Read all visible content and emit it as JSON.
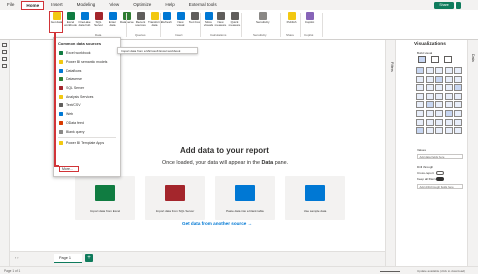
{
  "menu": {
    "items": [
      "File",
      "Home",
      "Insert",
      "Modeling",
      "View",
      "Optimize",
      "Help",
      "External tools"
    ],
    "active": "Home",
    "share_label": "Share"
  },
  "ribbon": {
    "buttons": [
      {
        "label": "Get data",
        "icon": "database-icon",
        "color": "#f2c811"
      },
      {
        "label": "Excel workbook",
        "icon": "excel-icon",
        "color": "#107c41"
      },
      {
        "label": "OneLake data hub",
        "icon": "onelake-icon",
        "color": "#0078d4"
      },
      {
        "label": "SQL Server",
        "icon": "sql-icon",
        "color": "#a4262c"
      },
      {
        "label": "Enter data",
        "icon": "table-icon",
        "color": "#0078d4"
      },
      {
        "label": "Dataverse",
        "icon": "dataverse-icon",
        "color": "#2e7d32"
      },
      {
        "label": "Recent sources",
        "icon": "recent-icon",
        "color": "#605e5c"
      },
      {
        "label": "Transform data",
        "icon": "transform-icon",
        "color": "#f2c811"
      },
      {
        "label": "Refresh",
        "icon": "refresh-icon",
        "color": "#0078d4"
      },
      {
        "label": "New visual",
        "icon": "chart-icon",
        "color": "#0078d4"
      },
      {
        "label": "Text box",
        "icon": "textbox-icon",
        "color": "#605e5c"
      },
      {
        "label": "More visuals",
        "icon": "visuals-icon",
        "color": "#0078d4"
      },
      {
        "label": "New measure",
        "icon": "measure-icon",
        "color": "#605e5c"
      },
      {
        "label": "Quick measure",
        "icon": "quick-measure-icon",
        "color": "#605e5c"
      },
      {
        "label": "Sensitivity",
        "icon": "shield-icon",
        "color": "#8a8886"
      },
      {
        "label": "Publish",
        "icon": "publish-icon",
        "color": "#f2c811"
      },
      {
        "label": "Copilot",
        "icon": "copilot-icon",
        "color": "#8764b8"
      }
    ],
    "groups": [
      "Data",
      "Queries",
      "Insert",
      "Calculations",
      "Sensitivity",
      "Share",
      "Copilot"
    ]
  },
  "dropdown": {
    "heading": "Common data sources",
    "items": [
      {
        "label": "Excel workbook",
        "color": "#107c41"
      },
      {
        "label": "Power BI semantic models",
        "color": "#f2c811"
      },
      {
        "label": "Dataflows",
        "color": "#0078d4"
      },
      {
        "label": "Dataverse",
        "color": "#2e7d32"
      },
      {
        "label": "SQL Server",
        "color": "#a4262c"
      },
      {
        "label": "Analysis Services",
        "color": "#f2c811"
      },
      {
        "label": "Text/CSV",
        "color": "#605e5c"
      },
      {
        "label": "Web",
        "color": "#0078d4"
      },
      {
        "label": "OData feed",
        "color": "#d83b01"
      },
      {
        "label": "Blank query",
        "color": "#8a8886"
      }
    ],
    "template_apps": "Power BI Template Apps",
    "more": "More...",
    "tooltip": "Import data from a Microsoft Excel workbook"
  },
  "canvas": {
    "title": "Add data to your report",
    "subtitle_prefix": "Once loaded, your data will appear in the",
    "subtitle_bold": "Data",
    "subtitle_suffix": "pane.",
    "cards": [
      {
        "label": "Import data from Excel",
        "color": "#107c41"
      },
      {
        "label": "Import data from SQL Server",
        "color": "#a4262c"
      },
      {
        "label": "Paste data into a blank table",
        "color": "#0078d4"
      },
      {
        "label": "Use sample data",
        "color": "#0078d4"
      }
    ],
    "other_source": "Get data from another source →"
  },
  "filters": {
    "label": "Filters"
  },
  "visualizations": {
    "title": "Visualizations",
    "build_visual": "Build visual",
    "values_label": "Values",
    "values_placeholder": "Add data fields here",
    "drill_label": "Drill through",
    "cross_report": "Cross-report",
    "cross_report_state": "Off",
    "keep_filters": "Keep all filters",
    "keep_filters_state": "On",
    "drill_placeholder": "Add drill-through fields here"
  },
  "data_pane": {
    "label": "Data"
  },
  "pages": {
    "tab": "Page 1",
    "add": "+"
  },
  "status": {
    "page_info": "Page 1 of 1",
    "update": "Update available (click to download)"
  }
}
